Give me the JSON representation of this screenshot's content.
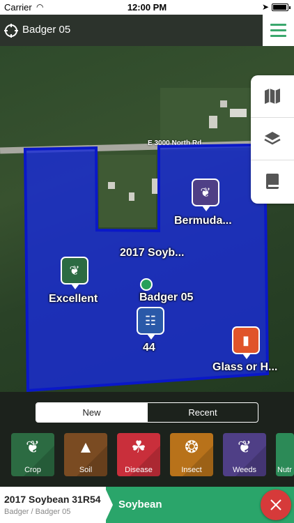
{
  "status_bar": {
    "carrier": "Carrier",
    "time": "12:00 PM"
  },
  "header": {
    "title": "Badger 05"
  },
  "map": {
    "road_label": "E 3000 North Rd",
    "field_color": "#1a2cd6",
    "labels": {
      "bermuda": "Bermuda...",
      "soybean": "2017 Soyb...",
      "excellent": "Excellent",
      "badger": "Badger 05",
      "count": "44",
      "glass": "Glass or H..."
    },
    "pin_colors": {
      "weeds": "#4f3f86",
      "crop": "#2c6b42",
      "sample": "#2a59a8",
      "other": "#e0542a"
    }
  },
  "side_toolbar": [
    "map-icon",
    "layers-icon",
    "book-icon"
  ],
  "segmented": {
    "new": "New",
    "recent": "Recent"
  },
  "categories": [
    {
      "label": "Crop",
      "color": "#2c6b42"
    },
    {
      "label": "Soil",
      "color": "#7a4b22"
    },
    {
      "label": "Disease",
      "color": "#c92f3b"
    },
    {
      "label": "Insect",
      "color": "#b8721a"
    },
    {
      "label": "Weeds",
      "color": "#4f3f86"
    },
    {
      "label": "Nutr",
      "color": "#2c8a57"
    }
  ],
  "footer": {
    "name": "2017 Soybean 31R54",
    "crumb": "Badger / Badger 05",
    "crop": "Soybean"
  }
}
